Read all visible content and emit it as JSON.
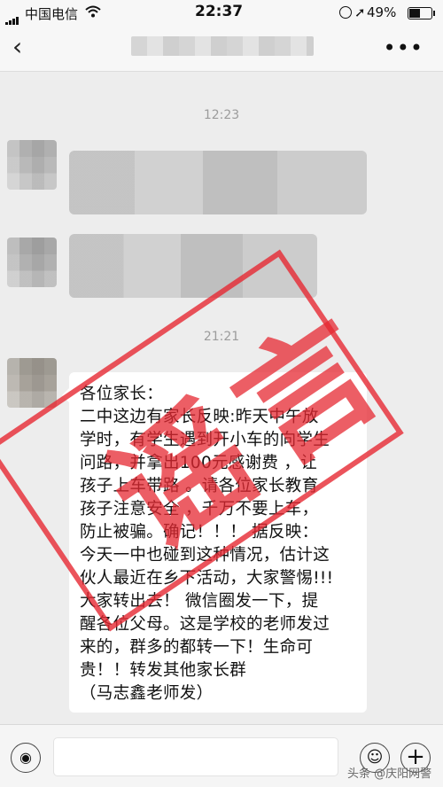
{
  "status_bar": {
    "carrier": "中国电信",
    "time": "22:37",
    "battery": "49%"
  },
  "nav": {
    "back_icon": "‹",
    "more_icon": "•••"
  },
  "chat": {
    "timestamp_1": "12:23",
    "timestamp_2": "21:21",
    "message_lines": [
      "各位家长：",
      "二中这边有家长反映:昨天中午放",
      "学时，有学生遇到开小车的向学生",
      "问路，并拿出100元感谢费 ，让",
      "孩子上车带路 。请各位家长教育",
      "孩子注意安全 ，千万不要上车，",
      "防止被骗。确记！！！ 据反映：",
      "今天一中也碰到这种情况，估计这",
      "伙人最近在乡下活动，大家警惕!!!",
      "大家转出去！ 微信圈发一下，提",
      "醒各位父母。这是学校的老师发过",
      "来的，群多的都转一下！生命可",
      "贵！！转发其他家长群",
      "    （马志鑫老师发）"
    ]
  },
  "stamp": {
    "text": "谣言",
    "color": "#e62832"
  },
  "input_bar": {
    "voice_icon": "voice-icon",
    "emoji_icon": "emoji-icon",
    "plus_icon": "plus-icon"
  },
  "watermark": "头条 @庆阳网警"
}
